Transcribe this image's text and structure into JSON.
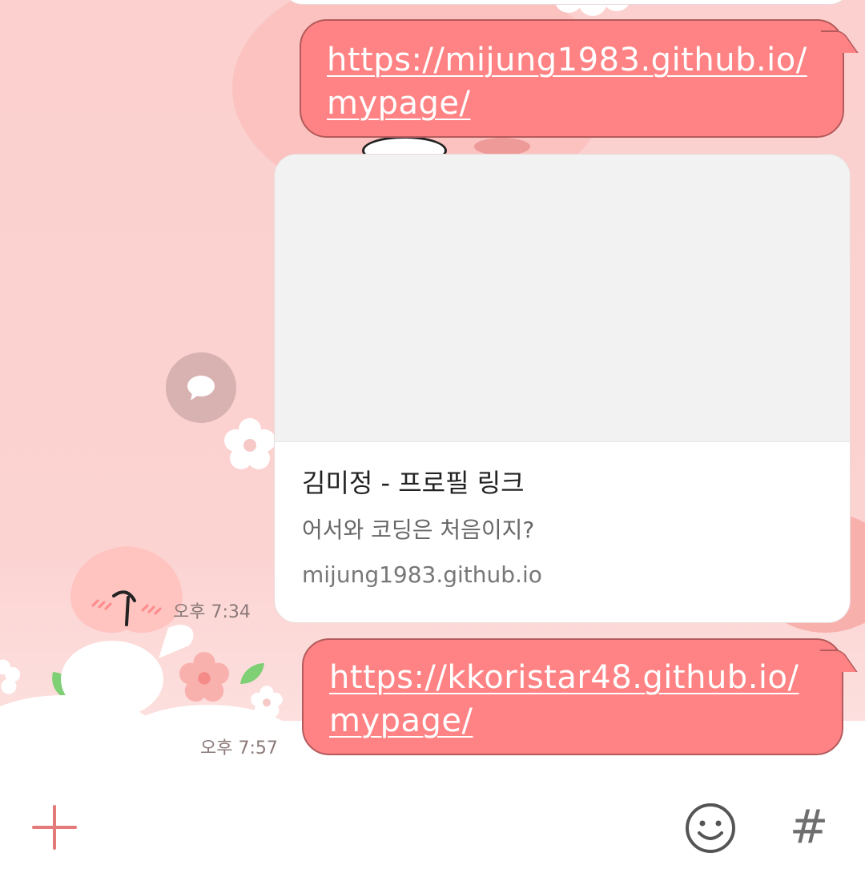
{
  "messages": [
    {
      "type": "link-text",
      "line1": "https://mijung1983.github.io/",
      "line2": "mypage/"
    },
    {
      "type": "link-preview",
      "title": "김미정 - 프로필 링크",
      "description": "어서와 코딩은 처음이지?",
      "domain": "mijung1983.github.io",
      "time": "오후 7:34"
    },
    {
      "type": "link-text",
      "line1": "https://kkoristar48.github.io/",
      "line2": "mypage/",
      "time": "오후 7:57"
    }
  ],
  "input_bar": {
    "plus_icon": "plus-icon",
    "emoji_icon": "emoji-icon",
    "hash_label": "#"
  },
  "colors": {
    "bubble": "#ff8384",
    "bubble_border": "#b45a5c",
    "background": "#fbd3d1",
    "accent": "#e57a7a"
  }
}
